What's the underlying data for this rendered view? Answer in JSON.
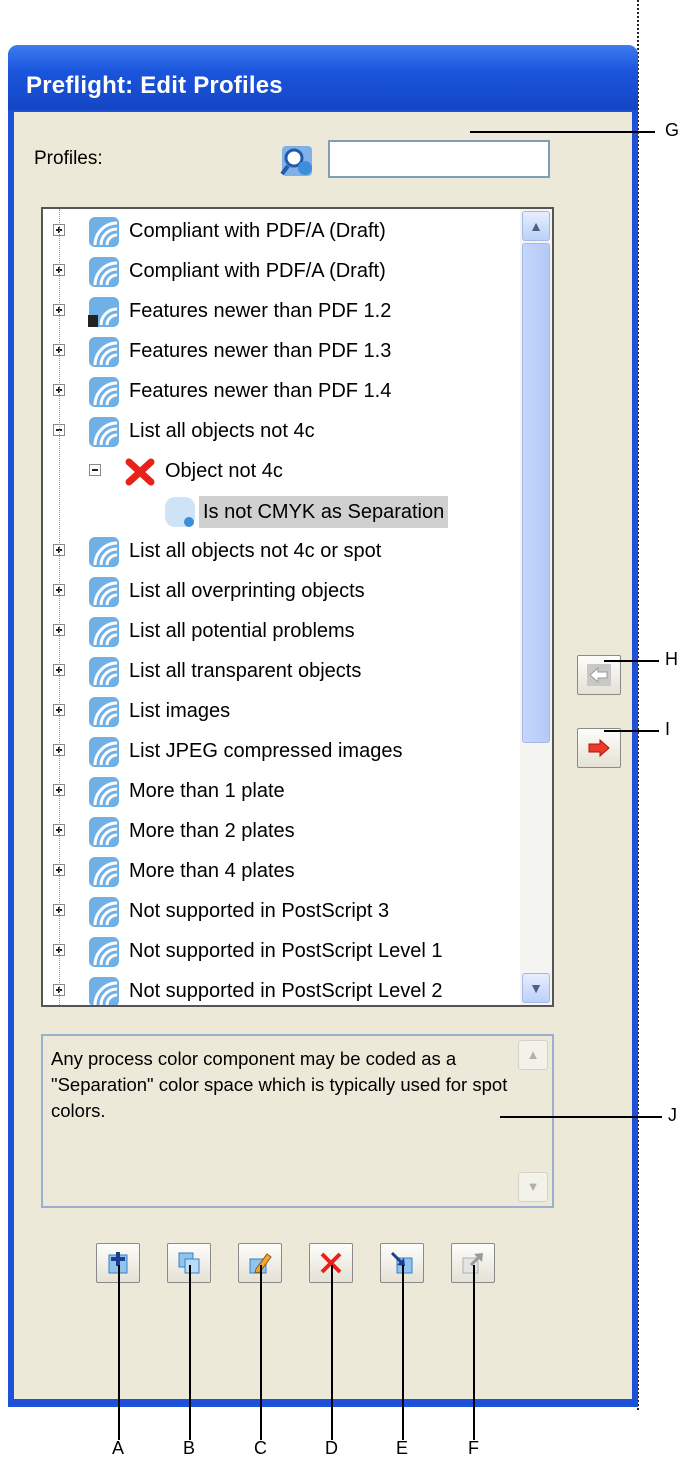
{
  "window": {
    "title": "Preflight: Edit Profiles"
  },
  "profiles_label": "Profiles:",
  "search": {
    "value": "",
    "icon": "search-profile-icon"
  },
  "tree": {
    "items": [
      {
        "label": "Compliant with PDF/A (Draft)",
        "expander": "plus",
        "level": 0,
        "icon": "profile-icon"
      },
      {
        "label": "Compliant with PDF/A (Draft)",
        "expander": "plus",
        "level": 0,
        "icon": "profile-icon"
      },
      {
        "label": "Features newer than PDF 1.2",
        "expander": "plus",
        "level": 0,
        "icon": "locked-profile-icon"
      },
      {
        "label": "Features newer than PDF 1.3",
        "expander": "plus",
        "level": 0,
        "icon": "profile-icon"
      },
      {
        "label": "Features newer than PDF 1.4",
        "expander": "plus",
        "level": 0,
        "icon": "profile-icon"
      },
      {
        "label": "List all objects not 4c",
        "expander": "minus",
        "level": 0,
        "icon": "profile-icon"
      },
      {
        "label": "Object not 4c",
        "expander": "minus",
        "level": 1,
        "icon": "error-x-icon"
      },
      {
        "label": "Is not CMYK as Separation",
        "expander": "none",
        "level": 2,
        "icon": "check-icon",
        "selected": true
      },
      {
        "label": "List all objects not 4c or spot",
        "expander": "plus",
        "level": 0,
        "icon": "profile-icon"
      },
      {
        "label": "List all overprinting objects",
        "expander": "plus",
        "level": 0,
        "icon": "profile-icon"
      },
      {
        "label": "List all potential problems",
        "expander": "plus",
        "level": 0,
        "icon": "profile-icon"
      },
      {
        "label": "List all transparent objects",
        "expander": "plus",
        "level": 0,
        "icon": "profile-icon"
      },
      {
        "label": "List images",
        "expander": "plus",
        "level": 0,
        "icon": "profile-icon"
      },
      {
        "label": "List JPEG compressed images",
        "expander": "plus",
        "level": 0,
        "icon": "profile-icon"
      },
      {
        "label": "More than 1 plate",
        "expander": "plus",
        "level": 0,
        "icon": "profile-icon"
      },
      {
        "label": "More than 2 plates",
        "expander": "plus",
        "level": 0,
        "icon": "profile-icon"
      },
      {
        "label": "More than 4 plates",
        "expander": "plus",
        "level": 0,
        "icon": "profile-icon"
      },
      {
        "label": "Not supported in PostScript 3",
        "expander": "plus",
        "level": 0,
        "icon": "profile-icon"
      },
      {
        "label": "Not supported in PostScript Level 1",
        "expander": "plus",
        "level": 0,
        "icon": "profile-icon"
      },
      {
        "label": "Not supported in PostScript Level 2",
        "expander": "plus",
        "level": 0,
        "icon": "profile-icon"
      }
    ]
  },
  "description": "Any process color component may be coded as a \"Separation\" color space which is typically used for spot colors.",
  "side_buttons": [
    {
      "name": "move-left-button",
      "icon": "arrow-left-icon",
      "enabled": false
    },
    {
      "name": "move-right-button",
      "icon": "arrow-right-icon",
      "enabled": true
    }
  ],
  "toolbar": [
    {
      "name": "new-profile-button",
      "icon": "new-icon"
    },
    {
      "name": "duplicate-profile-button",
      "icon": "duplicate-icon"
    },
    {
      "name": "edit-profile-button",
      "icon": "pencil-icon"
    },
    {
      "name": "delete-profile-button",
      "icon": "delete-x-icon"
    },
    {
      "name": "import-profile-button",
      "icon": "import-icon"
    },
    {
      "name": "export-profile-button",
      "icon": "export-icon"
    }
  ],
  "callouts": {
    "G": "G",
    "H": "H",
    "I": "I",
    "J": "J",
    "A": "A",
    "B": "B",
    "C": "C",
    "D": "D",
    "E": "E",
    "F": "F"
  },
  "colors": {
    "title_bar": "#1d52d8",
    "dialog_bg": "#ece9d8",
    "selection": "#d0d0d0",
    "error": "#e8211a"
  }
}
